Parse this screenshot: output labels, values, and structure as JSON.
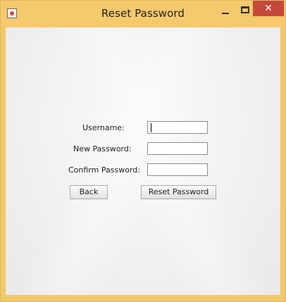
{
  "window": {
    "title": "Reset Password",
    "close_glyph": "✕",
    "icons": [
      "java-app-icon",
      "minimize-icon",
      "maximize-icon",
      "close-icon"
    ]
  },
  "form": {
    "username_label": "Username:",
    "username_value": "",
    "new_password_label": "New Password:",
    "new_password_value": "",
    "confirm_password_label": "Confirm Password:",
    "confirm_password_value": ""
  },
  "buttons": {
    "back_label": "Back",
    "reset_label": "Reset Password"
  },
  "colors": {
    "titlebar": "#f5c96c",
    "close_button": "#c7473b"
  }
}
